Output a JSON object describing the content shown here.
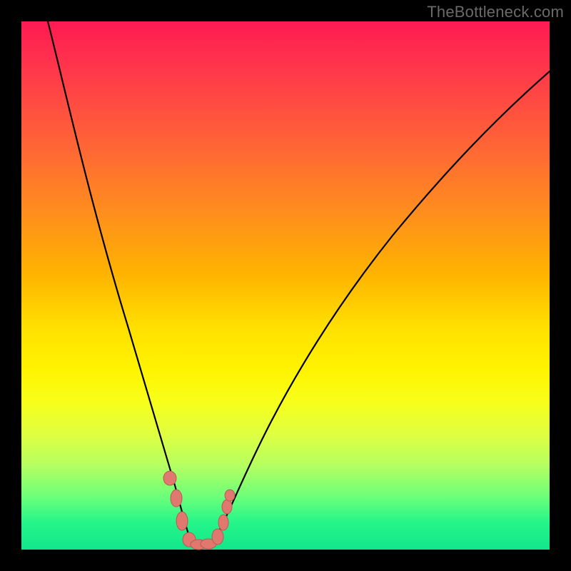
{
  "watermark": "TheBottleneck.com",
  "colors": {
    "page_bg": "#000000",
    "gradient_top": "#ff1a53",
    "gradient_mid1": "#ff8a20",
    "gradient_mid2": "#fff400",
    "gradient_bottom": "#12e68a",
    "curve_stroke": "#000000",
    "marker_fill": "#e07870",
    "marker_stroke": "#b85a52"
  },
  "chart_data": {
    "type": "line",
    "title": "",
    "xlabel": "",
    "ylabel": "",
    "xlim": [
      0,
      100
    ],
    "ylim": [
      0,
      100
    ],
    "grid": false,
    "legend": false,
    "series": [
      {
        "name": "bottleneck-curve",
        "x": [
          5,
          10,
          15,
          20,
          24,
          27,
          29,
          30,
          31,
          32,
          34,
          36,
          40,
          48,
          58,
          70,
          84,
          100
        ],
        "values": [
          100,
          82,
          61,
          41,
          24,
          12,
          4,
          1,
          0,
          0,
          1,
          3,
          9,
          22,
          38,
          55,
          72,
          88
        ]
      }
    ],
    "markers": [
      {
        "x": 26.0,
        "y": 14.0
      },
      {
        "x": 27.5,
        "y": 9.0
      },
      {
        "x": 28.5,
        "y": 4.5
      },
      {
        "x": 30.0,
        "y": 1.0
      },
      {
        "x": 31.5,
        "y": 0.5
      },
      {
        "x": 33.0,
        "y": 0.5
      },
      {
        "x": 35.0,
        "y": 2.0
      },
      {
        "x": 36.5,
        "y": 5.0
      },
      {
        "x": 37.5,
        "y": 8.0
      },
      {
        "x": 38.0,
        "y": 10.0
      }
    ],
    "annotations": []
  }
}
